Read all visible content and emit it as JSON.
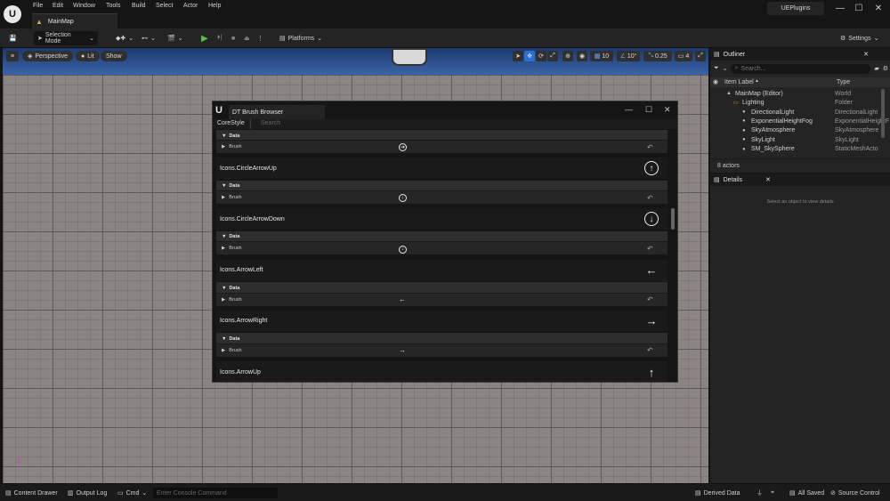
{
  "menu": [
    "File",
    "Edit",
    "Window",
    "Tools",
    "Build",
    "Select",
    "Actor",
    "Help"
  ],
  "map_tab": "MainMap",
  "project_name": "UEPlugins",
  "toolbar": {
    "selection_mode": "Selection Mode",
    "platforms": "Platforms",
    "settings": "Settings"
  },
  "viewport": {
    "perspective": "Perspective",
    "lit": "Lit",
    "show": "Show",
    "grid_snap": "10",
    "rotation_snap": "10°",
    "scale_snap": "0.25",
    "camera_speed": "4"
  },
  "outliner": {
    "tab": "Outliner",
    "search_placeholder": "Search...",
    "col_label": "Item Label",
    "col_type": "Type",
    "rows": [
      {
        "label": "MainMap (Editor)",
        "type": "World",
        "indent": 1
      },
      {
        "label": "Lighting",
        "type": "Folder",
        "indent": 2
      },
      {
        "label": "DirectionalLight",
        "type": "DirectionalLight",
        "indent": 3
      },
      {
        "label": "ExponentialHeightFog",
        "type": "ExponentialHeightF",
        "indent": 3
      },
      {
        "label": "SkyAtmosphere",
        "type": "SkyAtmosphere",
        "indent": 3
      },
      {
        "label": "SkyLight",
        "type": "SkyLight",
        "indent": 3
      },
      {
        "label": "SM_SkySphere",
        "type": "StaticMeshActo",
        "indent": 3
      }
    ],
    "count": "8 actors"
  },
  "details": {
    "tab": "Details",
    "empty_text": "Select an object to view details"
  },
  "brush_browser": {
    "title": "DT Brush Browser",
    "style_dropdown": "CoreStyle",
    "search_placeholder": "Search",
    "category_label": "Data",
    "brush_label": "Brush",
    "first_partial": {
      "brush_glyph": "➔"
    },
    "entries": [
      {
        "name": "Icons.CircleArrowUp",
        "glyph": "↑",
        "circled": true
      },
      {
        "name": "Icons.CircleArrowDown",
        "glyph": "↓",
        "circled": true
      },
      {
        "name": "Icons.ArrowLeft",
        "glyph": "←",
        "circled": false
      },
      {
        "name": "Icons.ArrowRight",
        "glyph": "→",
        "circled": false
      },
      {
        "name": "Icons.ArrowUp",
        "glyph": "↑",
        "circled": false
      }
    ]
  },
  "statusbar": {
    "content_drawer": "Content Drawer",
    "output_log": "Output Log",
    "cmd": "Cmd",
    "console_placeholder": "Enter Console Command",
    "derived_data": "Derived Data",
    "all_saved": "All Saved",
    "source_control": "Source Control"
  }
}
